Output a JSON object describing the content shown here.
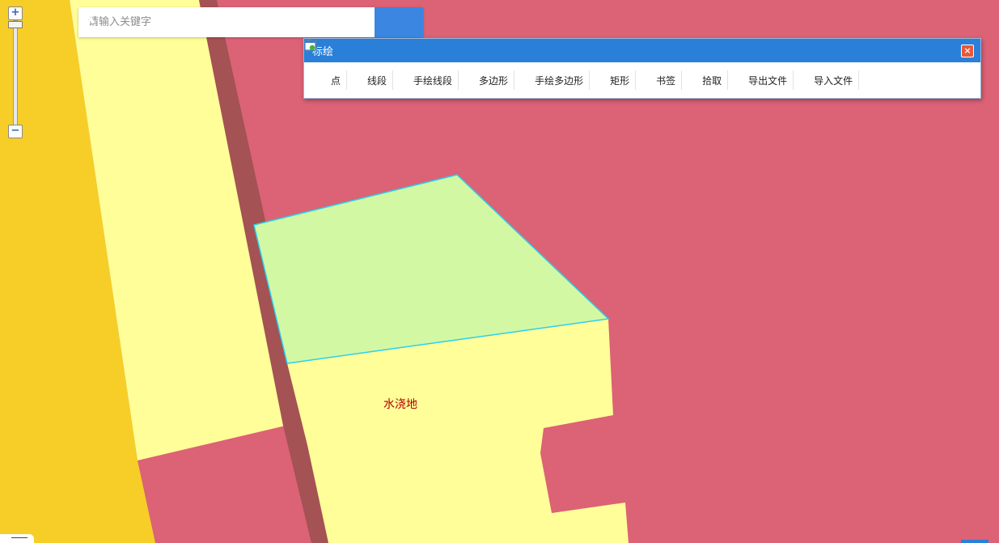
{
  "search": {
    "placeholder": "请输入关键字"
  },
  "zoom": {
    "in_label": "+",
    "out_label": "−"
  },
  "draw_panel": {
    "title": "标绘",
    "close_label": "×",
    "tools": [
      {
        "name": "tool-point",
        "label": "点",
        "icon": "point-icon"
      },
      {
        "name": "tool-polyline",
        "label": "线段",
        "icon": "polyline-icon"
      },
      {
        "name": "tool-freehand-line",
        "label": "手绘线段",
        "icon": "freehand-line-icon"
      },
      {
        "name": "tool-polygon",
        "label": "多边形",
        "icon": "polygon-icon"
      },
      {
        "name": "tool-freehand-polygon",
        "label": "手绘多边形",
        "icon": "freehand-polygon-icon"
      },
      {
        "name": "tool-rectangle",
        "label": "矩形",
        "icon": "rectangle-icon"
      },
      {
        "name": "tool-bookmark",
        "label": "书签",
        "icon": "star-icon"
      },
      {
        "name": "tool-pick",
        "label": "拾取",
        "icon": "lasso-icon"
      },
      {
        "name": "tool-export",
        "label": "导出文件",
        "icon": "export-file-icon"
      },
      {
        "name": "tool-import",
        "label": "导入文件",
        "icon": "import-file-icon"
      }
    ]
  },
  "map": {
    "label": "水浇地",
    "colors": {
      "road_orange": "#f6ce27",
      "yellow_parcel": "#fffe99",
      "red_land": "#dc6276",
      "brown_strip": "#a45254",
      "selected_green": "#d3f8a4",
      "selection_outline": "#27d1ee"
    }
  }
}
